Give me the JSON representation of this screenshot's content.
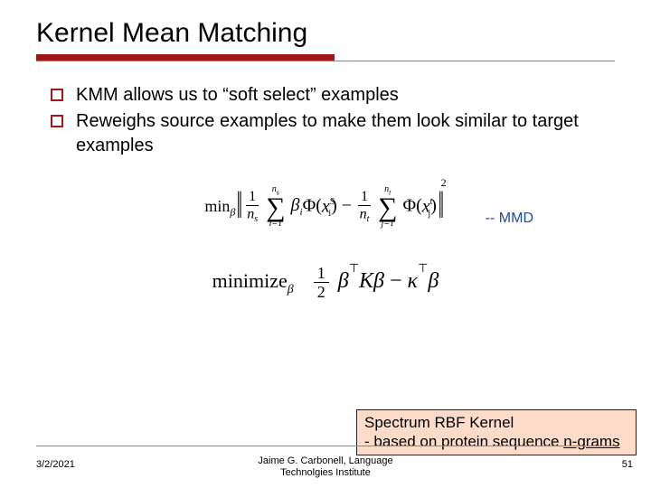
{
  "title": "Kernel Mean Matching",
  "bullets": [
    "KMM allows us to “soft select” examples",
    "Reweighs source examples to make them look similar to target examples"
  ],
  "formula1": {
    "min_label": "min",
    "min_sub": "β",
    "frac1_num": "1",
    "frac1_den_n": "n",
    "frac1_den_sub": "s",
    "sum1_top_n": "n",
    "sum1_top_sub": "s",
    "sum1_sigma": "∑",
    "sum1_bot": "i=1",
    "beta_i": "β",
    "beta_i_sub": "i",
    "phi": "Φ",
    "x": "x",
    "sup_S": "S",
    "sub_i": "i",
    "minus": " − ",
    "frac2_num": "1",
    "frac2_den_n": "n",
    "frac2_den_sub": "t",
    "sum2_top_n": "n",
    "sum2_top_sub": "t",
    "sum2_sigma": "∑",
    "sum2_bot": "j=1",
    "sup_t": "t",
    "sub_j": "j",
    "sq": "2"
  },
  "mmd_label": "-- MMD",
  "formula2": {
    "min_word": "minimize",
    "sub_beta": "β",
    "half_num": "1",
    "half_den": "2",
    "beta": "β",
    "T": "⊤",
    "K": "K",
    "minus": " − ",
    "kappa": "κ"
  },
  "kernel_box": {
    "line1": "Spectrum RBF Kernel",
    "line2": " - based on protein sequence ",
    "line3": "n-grams"
  },
  "footer": {
    "date": "3/2/2021",
    "center_line1": "Jaime G. Carbonell, Language",
    "center_line2": "Technolgies Institute",
    "page": "51"
  }
}
